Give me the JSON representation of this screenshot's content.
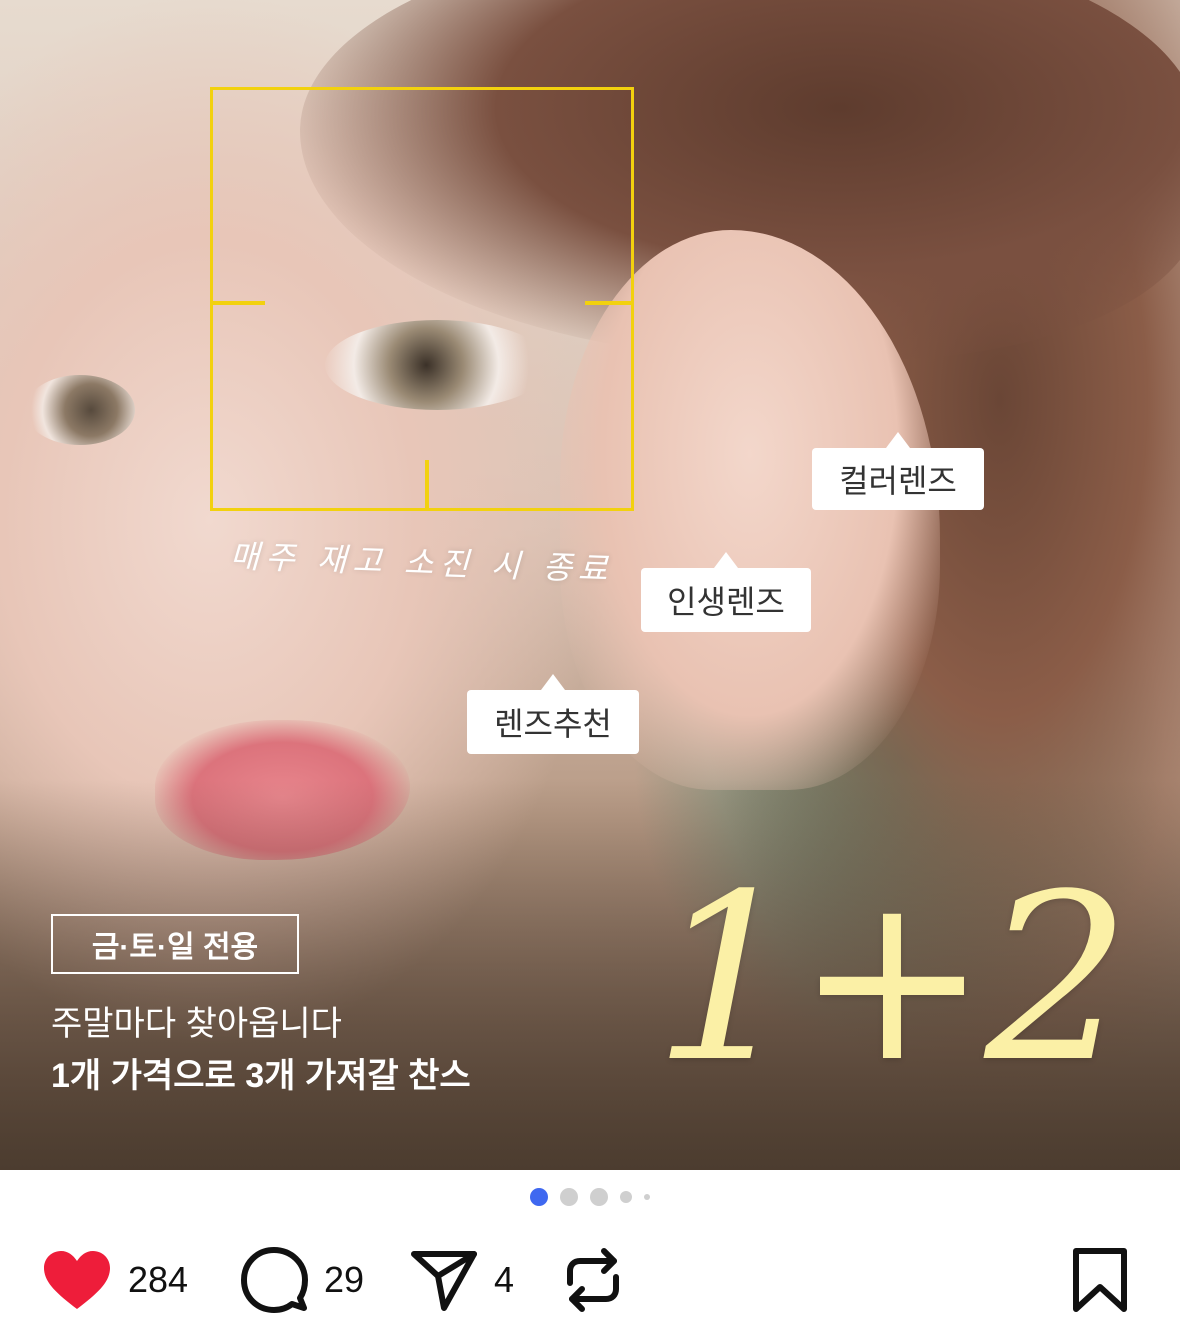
{
  "post": {
    "image": {
      "handwriting": "매주 재고 소진 시 종료",
      "tags": {
        "color_lens": "컬러렌즈",
        "life_lens": "인생렌즈",
        "lens_recommend": "렌즈추천"
      },
      "promo": {
        "badge": "금·토·일 전용",
        "line1": "주말마다 찾아옵니다",
        "line2": "1개 가격으로 3개 가져갈 찬스",
        "offer": "1+2"
      }
    },
    "pager": {
      "current": 1,
      "total": 5
    },
    "actions": {
      "likes": "284",
      "comments": "29",
      "shares": "4"
    }
  },
  "colors": {
    "accent": "#3f68f0",
    "like": "#ee1d3a",
    "focus_frame": "#f2d10e",
    "offer_text": "#fbf0a6"
  },
  "icons": {
    "like": "heart-icon",
    "comment": "comment-bubble-icon",
    "share": "send-icon",
    "repost": "repost-icon",
    "bookmark": "bookmark-icon"
  }
}
